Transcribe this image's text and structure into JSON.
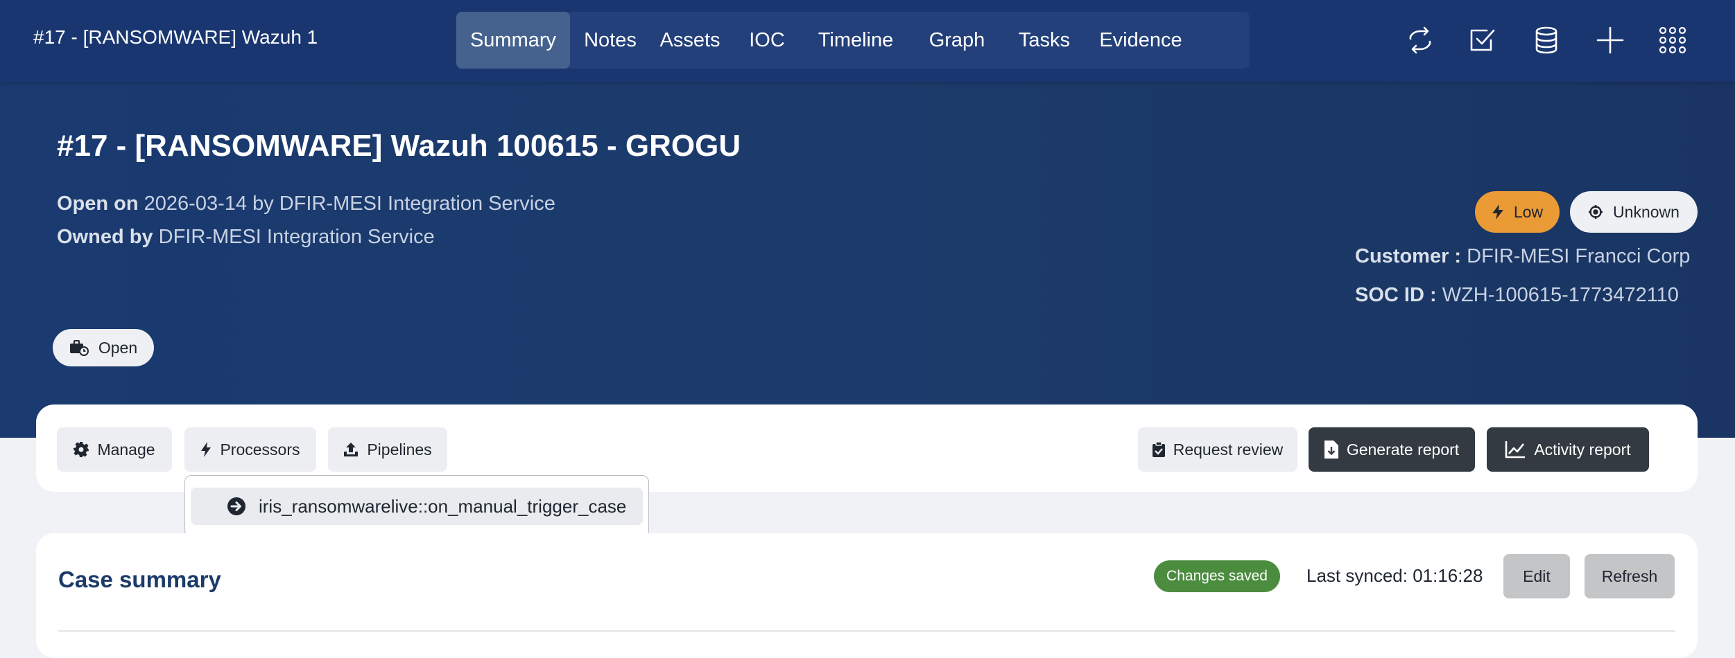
{
  "app": {
    "title": "#17 - [RANSOMWARE] Wazuh 1"
  },
  "nav": {
    "tabs": [
      {
        "label": "Summary",
        "active": true
      },
      {
        "label": "Notes"
      },
      {
        "label": "Assets"
      },
      {
        "label": "IOC"
      },
      {
        "label": "Timeline"
      },
      {
        "label": "Graph"
      },
      {
        "label": "Tasks"
      },
      {
        "label": "Evidence"
      }
    ],
    "icons": [
      "refresh-arrows-icon",
      "checkbox-icon",
      "database-icon",
      "plus-icon",
      "grid-menu-icon"
    ]
  },
  "case": {
    "title": "#17 - [RANSOMWARE] Wazuh 100615 - GROGU",
    "open_on_label": "Open on",
    "open_on_value": "2026-03-14 by DFIR-MESI Integration Service",
    "owned_by_label": "Owned by",
    "owned_by_value": "DFIR-MESI Integration Service",
    "severity": "Low",
    "classification": "Unknown",
    "customer_label": "Customer :",
    "customer_value": "DFIR-MESI Francci Corp",
    "soc_label": "SOC ID :",
    "soc_value": "WZH-100615-1773472110",
    "status": "Open"
  },
  "toolbar": {
    "manage": "Manage",
    "processors": "Processors",
    "pipelines": "Pipelines",
    "request_review": "Request review",
    "generate_report": "Generate report",
    "activity_report": "Activity report"
  },
  "processors_menu": {
    "items": [
      {
        "label": "iris_ransomwarelive::on_manual_trigger_case"
      }
    ]
  },
  "summary": {
    "title": "Case summary",
    "saved_badge": "Changes saved",
    "last_synced": "Last synced: 01:16:28",
    "edit": "Edit",
    "refresh": "Refresh"
  },
  "colors": {
    "header_bg": "#1a3670",
    "hero_bg": "#1c3b6c",
    "active_tab": "#45628f",
    "severity_low": "#ea9b35",
    "saved_badge": "#4b8c3e",
    "dark_button": "#333a41"
  }
}
